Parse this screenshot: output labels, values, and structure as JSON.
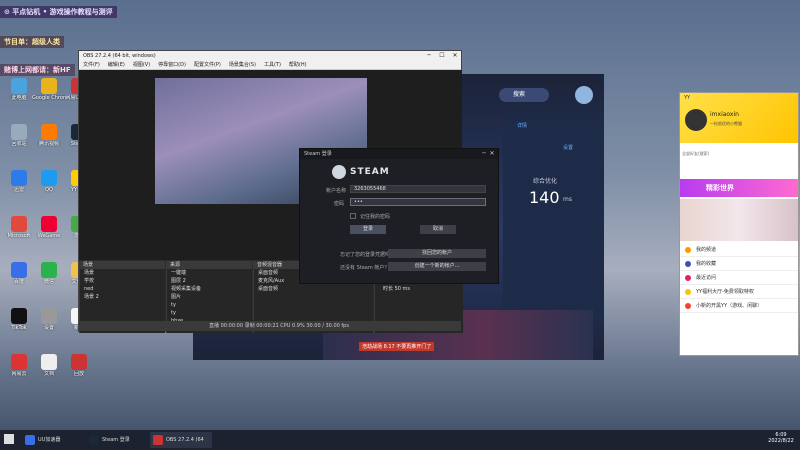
{
  "overlay": {
    "line1": "⊙ 平点钻机 • 游戏操作教程与测评",
    "line2": "节目单：超级人类",
    "line3": "赌博上网都请：新HF"
  },
  "desktop_icons": [
    {
      "label": "此电脑",
      "color": "#4aa3df"
    },
    {
      "label": "回收站",
      "color": "#9ab"
    },
    {
      "label": "迅雷",
      "color": "#2d7be8"
    },
    {
      "label": "Microsoft",
      "color": "#e04a3a"
    },
    {
      "label": "百度",
      "color": "#3a6ee8"
    },
    {
      "label": "TikTok",
      "color": "#111"
    },
    {
      "label": "网易云",
      "color": "#d33"
    },
    {
      "label": "Google Chrome",
      "color": "#e9b31d"
    },
    {
      "label": "腾讯视频",
      "color": "#ff7a00"
    },
    {
      "label": "QQ",
      "color": "#1d9bf0"
    },
    {
      "label": "WeGame",
      "color": "#e03"
    },
    {
      "label": "微信",
      "color": "#2ab34a"
    },
    {
      "label": "设置",
      "color": "#999"
    },
    {
      "label": "文档",
      "color": "#eee"
    },
    {
      "label": "网易UU加速",
      "color": "#c33"
    },
    {
      "label": "Steam",
      "color": "#1b2838"
    },
    {
      "label": "YY语音",
      "color": "#ffcc00"
    },
    {
      "label": "游戏",
      "color": "#4a4"
    },
    {
      "label": "文件夹",
      "color": "#f0c050"
    },
    {
      "label": "新建",
      "color": "#f5f5f5"
    },
    {
      "label": "回放",
      "color": "#c33"
    }
  ],
  "obs": {
    "title": "OBS 27.2.4 (64 bit, windows)",
    "menu": [
      "文件(F)",
      "编辑(E)",
      "视图(V)",
      "停靠窗口(D)",
      "配置文件(P)",
      "场景集合(S)",
      "工具(T)",
      "帮助(H)"
    ],
    "scenes_header": "场景",
    "scenes": [
      "场景",
      "学校",
      "ned",
      "场景 2"
    ],
    "sources_header": "来源",
    "sources": [
      "一键端",
      "图层 2",
      "视频采集设备",
      "图片",
      "ty",
      "ty",
      "bbxe",
      "显示器采集",
      "文本"
    ],
    "mixer_header": "音频混音器",
    "mixer_items": [
      "桌面音频",
      "麦克风/Aux",
      "桌面音频"
    ],
    "transition_label": "淡出",
    "duration_label": "时长",
    "duration_value": "50 ms",
    "status": "直播 00:00:00   录制 00:00:21   CPU 0.9%  30.00 / 30.00 fps"
  },
  "steam": {
    "title": "Steam 登录",
    "brand": "STEAM",
    "account_label": "帐户名称",
    "account_value": "3263055468",
    "password_label": "密码",
    "password_value": "•••",
    "remember": "记住我的密码",
    "login_btn": "登录",
    "cancel_btn": "取消",
    "forgot_label": "忘记了您的登录凭据吗？",
    "forgot_btn": "找回您的帐户",
    "noacct_label": "还没有 Steam 帐户？",
    "create_btn": "创建一个新的帐户..."
  },
  "uu": {
    "search": "搜索",
    "tab_detail": "详情",
    "tab_settings": "设置",
    "optimize_label": "综合优化",
    "optimize_value": "140",
    "ms": "ms",
    "banner": "浩劫战场 8.17 不要再推开门了"
  },
  "yy": {
    "brand": "YY",
    "username": "imxiaoxin",
    "subtitle": "一粒很优的小熊猫",
    "search": "全部好友(搜索)",
    "banner": "精彩世界",
    "items": [
      "我的频道",
      "我的收藏",
      "最近访问",
      "YY福利大厅-免费领取特权",
      "小新的开黑YY（游戏、闲聊）"
    ],
    "item_ids": [
      "2004.45w",
      "2465.85"
    ]
  },
  "taskbar": {
    "items": [
      "UU加速器",
      "Steam 登录",
      "OBS 27.2.4 (64 bi..."
    ],
    "time": "6:09",
    "date": "2022/8/22"
  }
}
